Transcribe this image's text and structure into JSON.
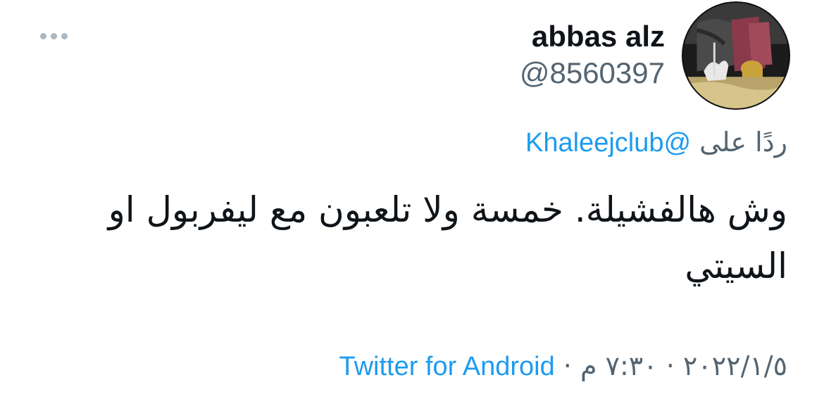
{
  "author": {
    "name": "abbas alz",
    "handle": "@8560397",
    "avatar_icon": "avatar-photo"
  },
  "more_options_icon": "more-horizontal-icon",
  "reply": {
    "prefix": "ردًا على",
    "mention": "@Khaleejclub"
  },
  "tweet": {
    "text": "وش هالفشيلة.  خمسة ولا تلعبون مع ليفربول او السيتي"
  },
  "meta": {
    "date": "٢٠٢٢/١/٥",
    "separator": "·",
    "time": "٧:٣٠ م",
    "source": "Twitter for Android"
  },
  "colors": {
    "link": "#1d9bf0",
    "secondary_text": "#536471",
    "primary_text": "#0f1419"
  }
}
